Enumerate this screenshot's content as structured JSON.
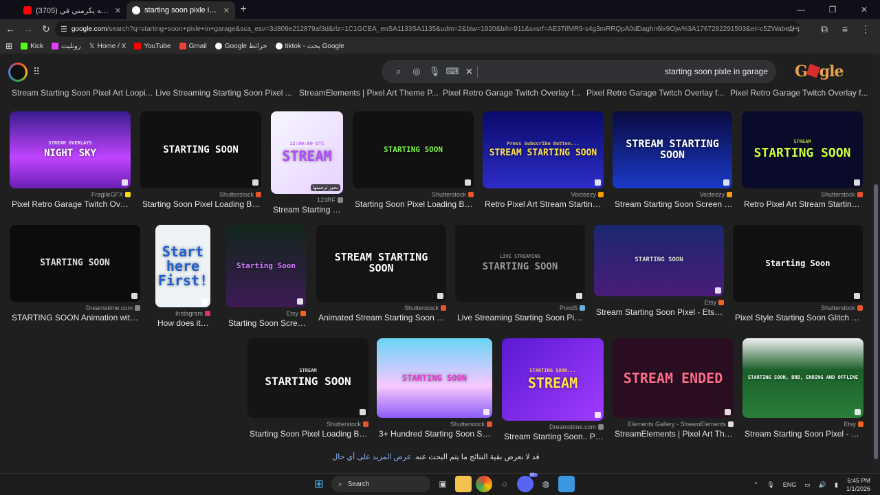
{
  "tabs": [
    {
      "title": "(3705) الجنة الله يكرمني في",
      "color": "#ff0000"
    },
    {
      "title": "starting soon pixle in garage -",
      "color": "#4285f4"
    }
  ],
  "address": {
    "host": "google.com",
    "rest": "/search?q=starting+soon+pixle+in+garage&sca_esv=3d809e212879af3d&rlz=1C1GCEA_enSA1133SA1135&udm=2&biw=1920&bih=911&sxsrf=AE3TifMR9-s4g3mRRQpA0dDaghn6lx9Ojw%3A1767282291503&ei=c5ZWabe1Hp6Mxc8P..."
  },
  "bookmarks": [
    {
      "label": "Kick",
      "color": "#53fc18"
    },
    {
      "label": "رونليت",
      "color": "#e040fb"
    },
    {
      "label": "Home / X",
      "color": "#ffffff"
    },
    {
      "label": "YouTube",
      "color": "#ff0000"
    },
    {
      "label": "Gmail",
      "color": "#ea4335"
    },
    {
      "label": "Google خرائط",
      "color": "#34a853"
    },
    {
      "label": "tiktok - بحث Google",
      "color": "#4285f4"
    }
  ],
  "search": {
    "query": "starting soon pixle in garage"
  },
  "logo": {
    "text_left": "G",
    "text_right": "gle"
  },
  "top_captions": [
    "Stream Starting Soon Pixel Art Loopi...",
    "Live Streaming Starting Soon Pixel ...",
    "StreamElements | Pixel Art Theme P...",
    "Pixel Retro Garage Twitch Overlay f...",
    "Pixel Retro Garage Twitch Overlay f...",
    "Pixel Retro Garage Twitch Overlay f..."
  ],
  "rows": [
    [
      {
        "thumb": "NIGHT SKY",
        "sub": "STREAM OVERLAYS",
        "source": "FragileGFX",
        "srccolor": "#f9d71c",
        "caption": "Pixel Retro Garage Twitch Overl..."
      },
      {
        "thumb": "STARTING SOON",
        "source": "Shutterstock",
        "srccolor": "#e8542c",
        "caption": "Starting Soon Pixel Loading Bar ..."
      },
      {
        "thumb": "STREAM",
        "sub": "12:00:00 UTC",
        "source": "123RF",
        "srccolor": "#888888",
        "caption": "Stream Starting St...",
        "overlay": "بحوز ترجمتها"
      },
      {
        "thumb": "STARTING SOON",
        "source": "Shutterstock",
        "srccolor": "#e8542c",
        "caption": "Starting Soon Pixel Loading Bar ..."
      },
      {
        "thumb": "STREAM STARTING SOON",
        "sub": "Press Subscribe Button...",
        "source": "Vecteezy",
        "srccolor": "#f59e0b",
        "caption": "Retro Pixel Art Stream Starting S..."
      },
      {
        "thumb": "STREAM STARTING SOON",
        "source": "Vecteezy",
        "srccolor": "#f59e0b",
        "caption": "Stream Starting Soon Screen wit..."
      },
      {
        "thumb": "STARTING SOON",
        "sub": "STREAM",
        "source": "Shutterstock",
        "srccolor": "#e8542c",
        "caption": "Retro Pixel Art Stream Starting S..."
      }
    ],
    [
      {
        "thumb": "STARTING SOON",
        "source": "Dreamstime.com",
        "srccolor": "#888888",
        "caption": "STARTING SOON Animation with ..."
      },
      {
        "thumb": "Start here First!",
        "source": "Instagram",
        "srccolor": "#e1306c",
        "caption": "How does it wor..."
      },
      {
        "thumb": "Starting Soon",
        "source": "Etsy",
        "srccolor": "#f1641e",
        "caption": "Starting Soon Scree..."
      },
      {
        "thumb": "STREAM STARTING SOON",
        "source": "Shutterstock",
        "srccolor": "#e8542c",
        "caption": "Animated Stream Starting Soon Gli..."
      },
      {
        "thumb": "STARTING SOON",
        "sub": "LIVE STREAMING",
        "source": "Pond5",
        "srccolor": "#6ab0de",
        "caption": "Live Streaming Starting Soon Pixel ..."
      },
      {
        "thumb": "STARTING SOON",
        "source": "Etsy",
        "srccolor": "#f1641e",
        "caption": "Stream Starting Soon Pixel - Etsy A..."
      },
      {
        "thumb": "Starting Soon",
        "source": "Shutterstock",
        "srccolor": "#e8542c",
        "caption": "Pixel Style Starting Soon Glitch Tex..."
      }
    ],
    [
      {
        "thumb": "STARTING SOON",
        "sub": "STREAM",
        "source": "Shutterstock",
        "srccolor": "#e8542c",
        "caption": "Starting Soon Pixel Loading Bar ..."
      },
      {
        "thumb": "STARTING SOON",
        "source": "Shutterstock",
        "srccolor": "#e8542c",
        "caption": "3+ Hundred Starting Soon Scr..."
      },
      {
        "thumb": "STREAM",
        "sub": "STARTING SOON...",
        "source": "Dreamstime.com",
        "srccolor": "#888888",
        "caption": "Stream Starting Soon.. Phr..."
      },
      {
        "thumb": "STREAM ENDED",
        "source": "Elements Gallery - StreamElements",
        "srccolor": "#dddddd",
        "caption": "StreamElements | Pixel Art The..."
      },
      {
        "thumb": "STARTING SOON, BRB, ENDING AND OFFLINE",
        "source": "Etsy",
        "srccolor": "#f1641e",
        "caption": "Stream Starting Soon Pixel - Etsy"
      }
    ]
  ],
  "more": {
    "text": "قد لا نعرض بقية النتائج ما يتم البحث عنه.",
    "link": "عرض المزيد على أي حال"
  },
  "taskbar": {
    "search": "Search",
    "lang": "ENG",
    "time": "6:45 PM",
    "date": "1/1/2026",
    "badge": "99+"
  }
}
